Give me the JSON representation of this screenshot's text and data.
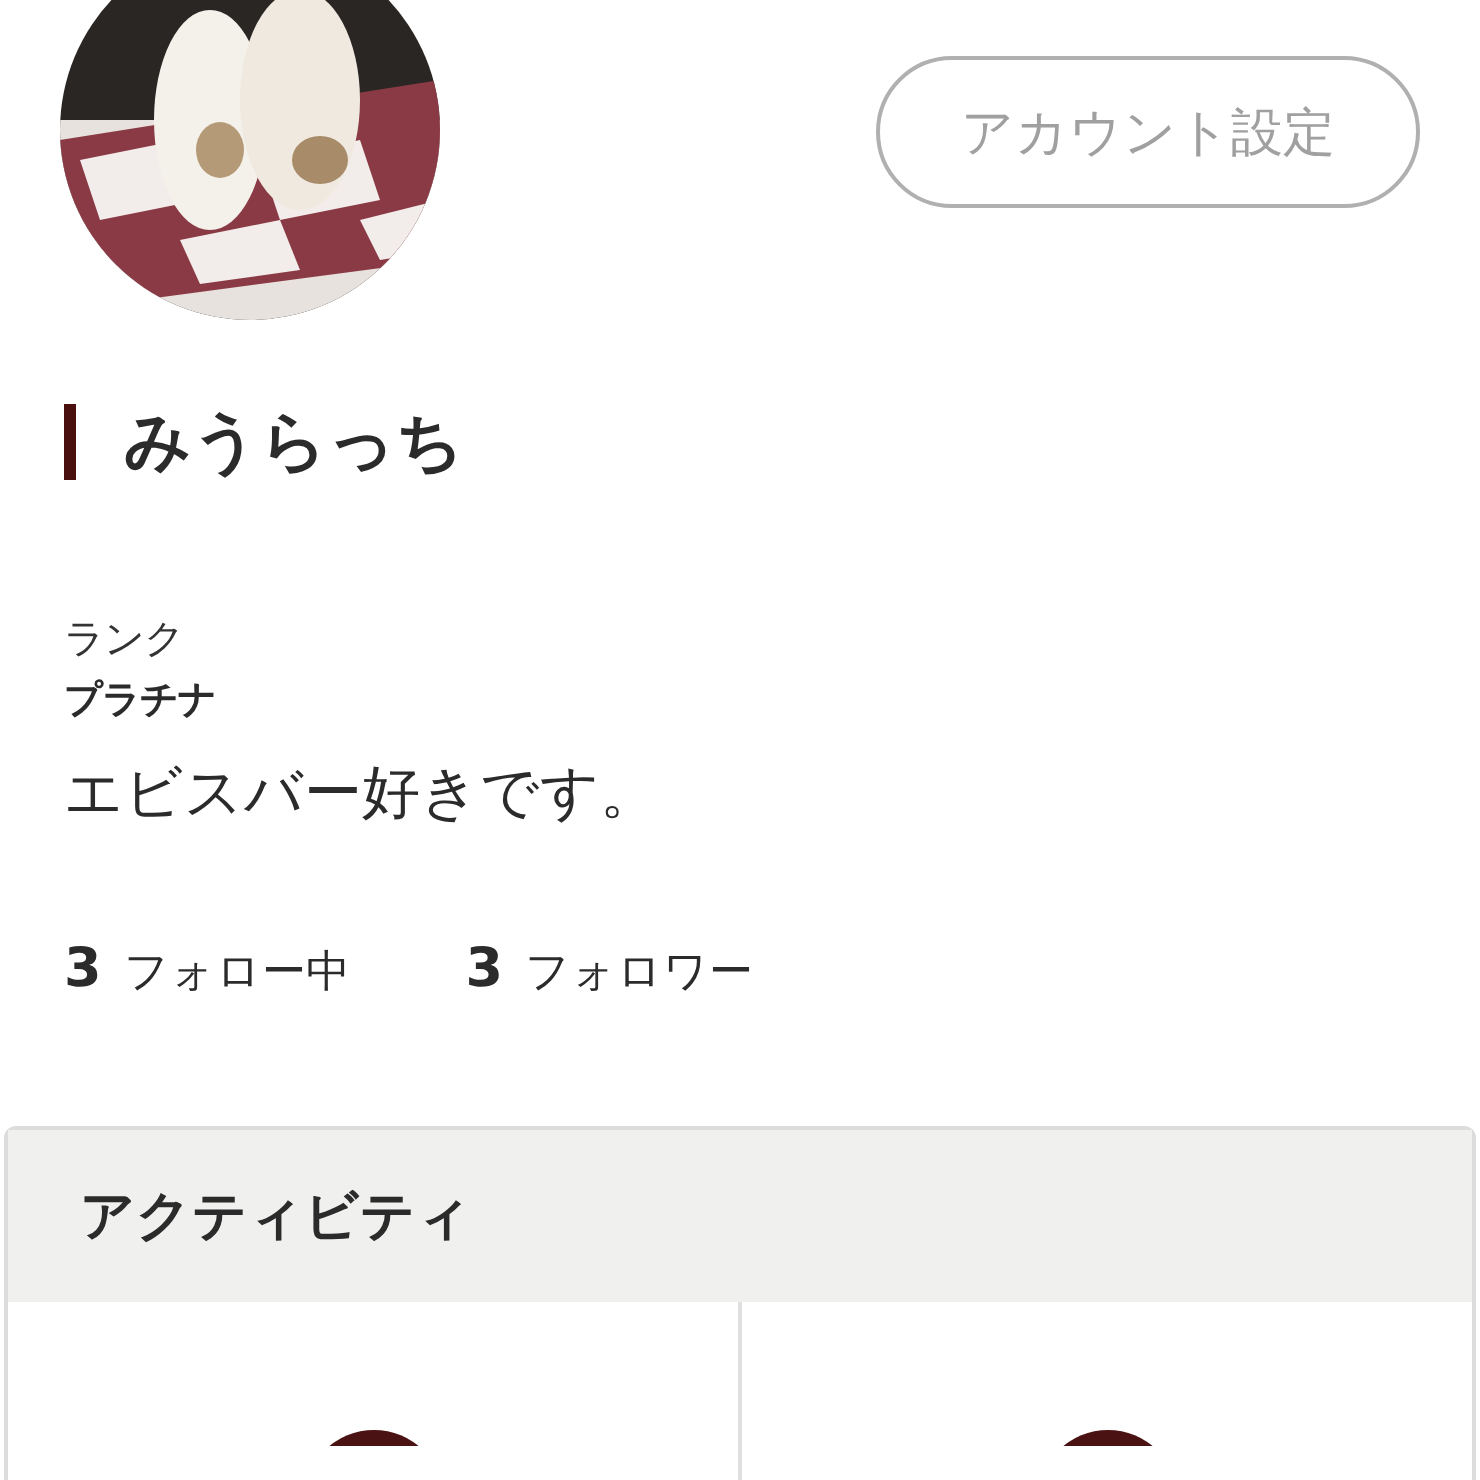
{
  "profile": {
    "account_button": "アカウント設定",
    "name": "みうらっち",
    "rank_label": "ランク",
    "rank": "プラチナ",
    "bio": "エビスバー好きです。",
    "stats": [
      {
        "count": "3",
        "label": "フォロー中"
      },
      {
        "count": "3",
        "label": "フォロワー"
      }
    ]
  },
  "activity": {
    "title": "アクティビティ",
    "tiles": [
      {
        "kind": "icon"
      },
      {
        "kind": "icon"
      }
    ]
  }
}
